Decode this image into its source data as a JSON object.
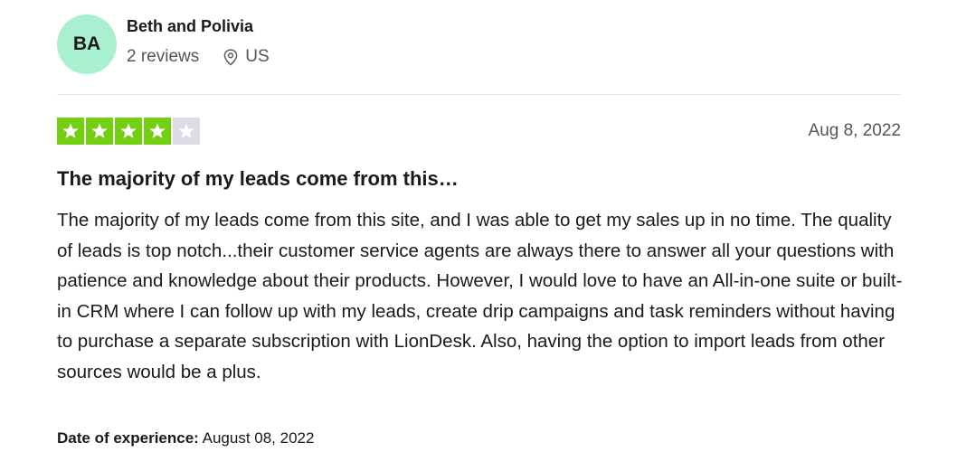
{
  "reviewer": {
    "initials": "BA",
    "name": "Beth and Polivia",
    "reviews_count": "2 reviews",
    "country": "US",
    "avatar_color": "#a8f0cf"
  },
  "review": {
    "rating": 4,
    "rating_max": 5,
    "star_color": "#73cf11",
    "date": "Aug 8, 2022",
    "title": "The majority of my leads come from this…",
    "body": "The majority of my leads come from this site, and I was able to get my sales up in no time. The quality of leads is top notch...their customer service agents are always there to answer all your questions with patience and knowledge about their products. However, I would love to have an All-in-one suite or built-in CRM where I can follow up with my leads, create drip campaigns and task reminders without having to purchase a separate subscription with LionDesk. Also, having the option to import leads from other sources would be a plus.",
    "experience_label": "Date of experience:",
    "experience_date": " August 08, 2022"
  },
  "icons": {
    "location": "location-pin-icon",
    "star": "star-icon"
  }
}
